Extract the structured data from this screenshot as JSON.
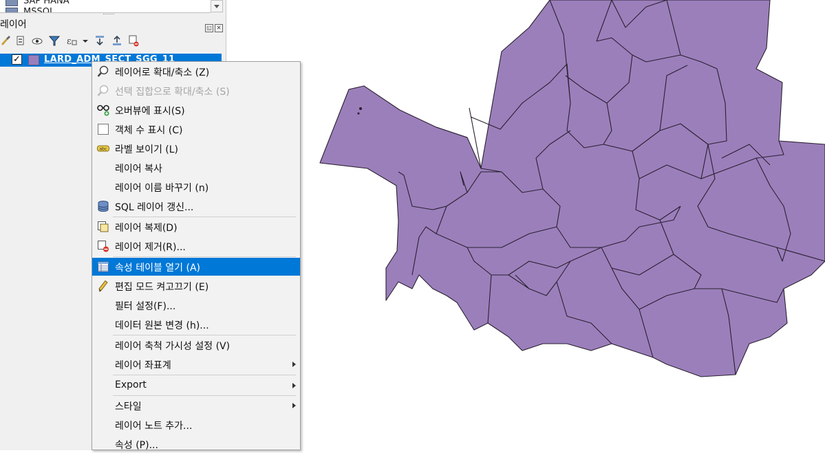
{
  "browser": {
    "items": [
      {
        "label": "SAP HANA",
        "icon": "database-icon"
      },
      {
        "label": "MSSQL",
        "icon": "database-icon"
      }
    ]
  },
  "layers_panel": {
    "title": "레이어",
    "layer": {
      "name": "LARD_ADM_SECT_SGG_11",
      "checked": "✓",
      "swatch_color": "#9b7fbb"
    }
  },
  "map": {
    "fill_color": "#9b7fbb",
    "stroke_color": "#2a2030"
  },
  "context_menu": {
    "items": [
      {
        "label": "레이어로 확대/축소 (Z)",
        "icon": "zoom-to-layer-icon"
      },
      {
        "label": "선택 집합으로 확대/축소 (S)",
        "icon": "zoom-to-selection-icon",
        "disabled": true
      },
      {
        "label": "오버뷰에 표시(S)",
        "icon": "overview-icon"
      },
      {
        "label": "객체 수 표시 (C)",
        "icon": "checkbox-icon"
      },
      {
        "label": "라벨 보이기 (L)",
        "icon": "label-icon"
      },
      {
        "label": "레이어 복사"
      },
      {
        "label": "레이어 이름 바꾸기 (n)"
      },
      {
        "label": "SQL 레이어 갱신...",
        "icon": "database-icon"
      },
      {
        "label": "레이어 복제(D)",
        "icon": "duplicate-layer-icon"
      },
      {
        "label": "레이어 제거(R)...",
        "icon": "remove-layer-icon"
      },
      {
        "label": "속성 테이블 열기 (A)",
        "icon": "attribute-table-icon",
        "highlight": true
      },
      {
        "label": "편집 모드 켜고끄기 (E)",
        "icon": "pencil-icon"
      },
      {
        "label": "필터 설정(F)..."
      },
      {
        "label": "데이터 원본 변경 (h)..."
      },
      {
        "label": "레이어 축척 가시성 설정 (V)"
      },
      {
        "label": "레이어 좌표계",
        "submenu": true
      },
      {
        "label": "Export",
        "submenu": true
      },
      {
        "label": "스타일",
        "submenu": true
      },
      {
        "label": "레이어 노트 추가..."
      },
      {
        "label": "속성 (P)..."
      }
    ]
  }
}
